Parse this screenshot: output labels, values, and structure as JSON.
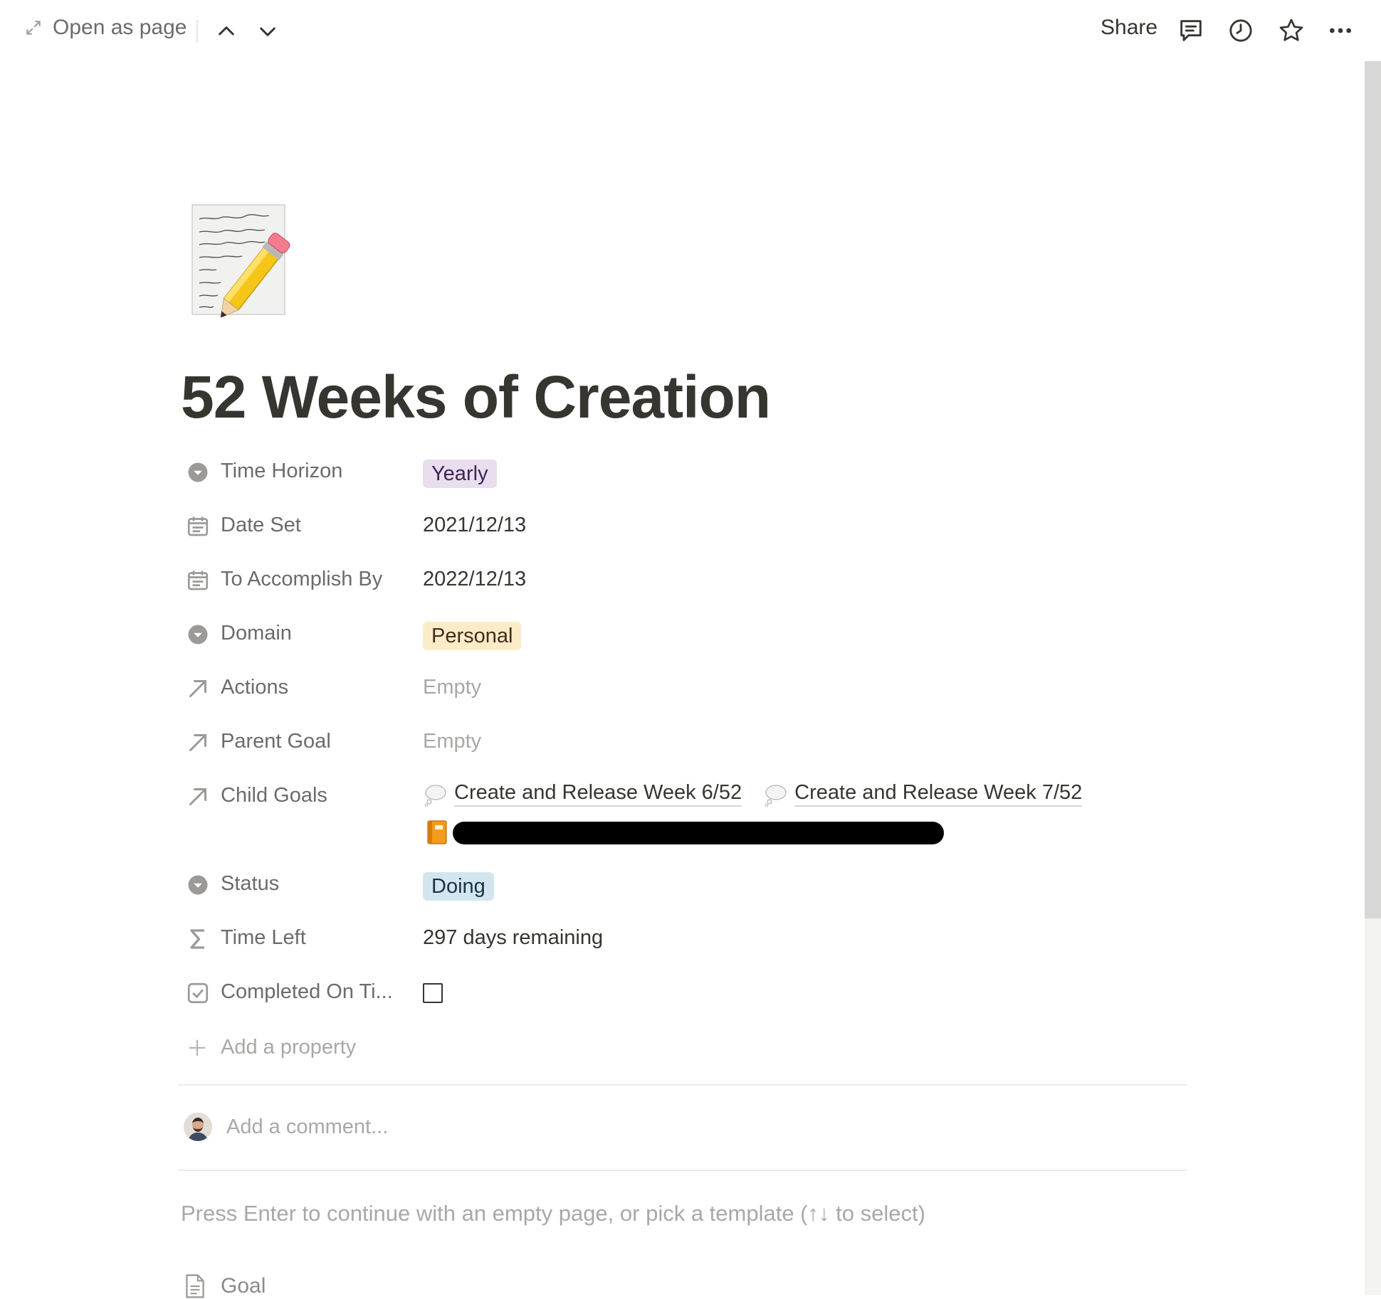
{
  "topbar": {
    "open_as_page": "Open as page",
    "share": "Share"
  },
  "page": {
    "title": "52 Weeks of Creation"
  },
  "properties": {
    "time_horizon": {
      "label": "Time Horizon",
      "value": "Yearly"
    },
    "date_set": {
      "label": "Date Set",
      "value": "2021/12/13"
    },
    "to_accomplish_by": {
      "label": "To Accomplish By",
      "value": "2022/12/13"
    },
    "domain": {
      "label": "Domain",
      "value": "Personal"
    },
    "actions": {
      "label": "Actions",
      "value": "Empty"
    },
    "parent_goal": {
      "label": "Parent Goal",
      "value": "Empty"
    },
    "child_goals": {
      "label": "Child Goals",
      "items": [
        "Create and Release Week 6/52",
        "Create and Release Week 7/52"
      ]
    },
    "status": {
      "label": "Status",
      "value": "Doing"
    },
    "time_left": {
      "label": "Time Left",
      "value": "297 days remaining"
    },
    "completed_on_time": {
      "label": "Completed On Ti..."
    },
    "add_property": "Add a property"
  },
  "comment": {
    "placeholder": "Add a comment..."
  },
  "hint": "Press Enter to continue with an empty page, or pick a template (↑↓ to select)",
  "templates": [
    "Goal"
  ],
  "colors": {
    "tag_purple": "#e8deee",
    "tag_yellow": "#fbecc8",
    "tag_blue": "#d3e5ef",
    "text": "#37352f",
    "muted": "#a8a8a6"
  },
  "icons": {
    "time_horizon": "select-icon",
    "date_set": "calendar-icon",
    "to_accomplish_by": "calendar-icon",
    "domain": "select-icon",
    "actions": "relation-arrow-icon",
    "parent_goal": "relation-arrow-icon",
    "child_goals": "relation-arrow-icon",
    "status": "select-icon",
    "time_left": "sigma-icon",
    "completed_on_time": "checkbox-icon"
  }
}
